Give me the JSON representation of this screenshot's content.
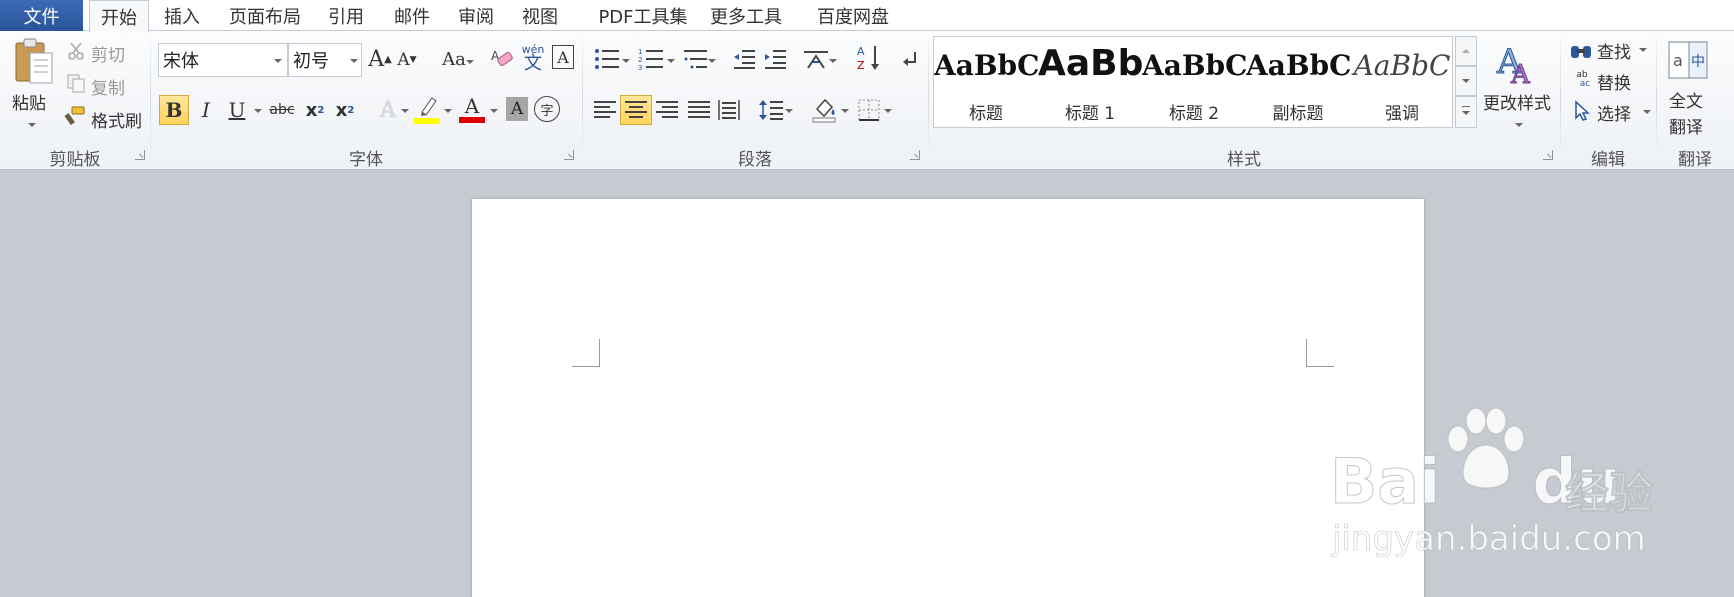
{
  "tabs": {
    "file": "文件",
    "items": [
      "开始",
      "插入",
      "页面布局",
      "引用",
      "邮件",
      "审阅",
      "视图",
      "PDF工具集",
      "更多工具",
      "百度网盘"
    ],
    "active": "开始"
  },
  "clipboard": {
    "paste": "粘贴",
    "cut": "剪切",
    "copy": "复制",
    "format_painter": "格式刷",
    "label": "剪贴板"
  },
  "font": {
    "name": "宋体",
    "size": "初号",
    "label": "字体",
    "grow": "A",
    "shrink": "A",
    "change_case": "Aa",
    "bold": "B",
    "italic": "I",
    "underline": "U",
    "strike": "abc",
    "sub": "x",
    "sup": "x",
    "clear_char": "A",
    "enclose": "字",
    "phonetic": "wén",
    "phonetic_char": "文",
    "border_char": "A",
    "shading_char": "A",
    "font_color_char": "A",
    "text_effect": "A"
  },
  "paragraph": {
    "label": "段落"
  },
  "styles": {
    "label": "样式",
    "items": [
      {
        "sample": "AaBbC",
        "name": "标题"
      },
      {
        "sample": "AaBb",
        "name": "标题 1"
      },
      {
        "sample": "AaBbC",
        "name": "标题 2"
      },
      {
        "sample": "AaBbC",
        "name": "副标题"
      },
      {
        "sample": "AaBbC",
        "name": "强调"
      }
    ],
    "change_styles": "更改样式"
  },
  "editing": {
    "label": "编辑",
    "find": "查找",
    "replace": "替换",
    "select": "选择"
  },
  "translate": {
    "label": "翻译",
    "full_line1": "全文",
    "full_line2": "翻译"
  },
  "watermark": {
    "brand": "Bai",
    "brand_tail": "du",
    "suffix": "经验",
    "url": "jingyan.baidu.com"
  },
  "colors": {
    "accent": "#2b579a",
    "highlight": "#ffff00",
    "font_color": "#e00000",
    "active_button": "#ffd35e"
  }
}
